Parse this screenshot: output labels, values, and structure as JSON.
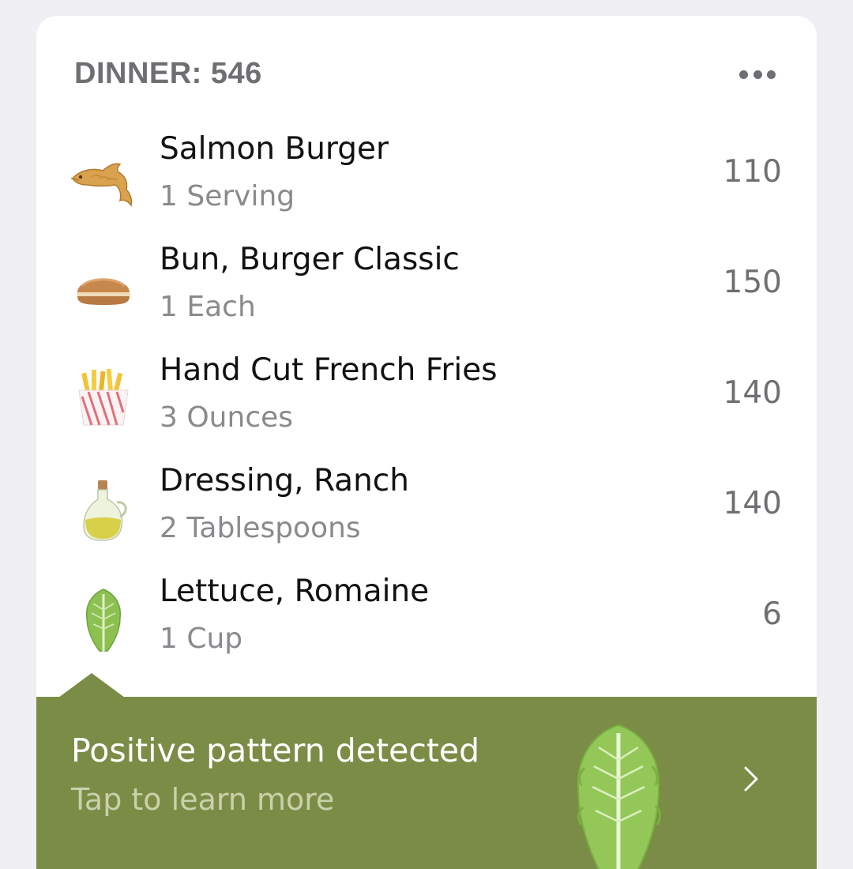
{
  "meal": {
    "header": "DINNER: 546",
    "more_icon": "more-horizontal-icon"
  },
  "items": [
    {
      "name": "Salmon Burger",
      "quantity": "1 Serving",
      "calories": "110",
      "icon": "fish-icon"
    },
    {
      "name": "Bun, Burger Classic",
      "quantity": "1 Each",
      "calories": "150",
      "icon": "bun-icon"
    },
    {
      "name": "Hand Cut French Fries",
      "quantity": "3 Ounces",
      "calories": "140",
      "icon": "fries-icon"
    },
    {
      "name": "Dressing, Ranch",
      "quantity": "2 Tablespoons",
      "calories": "140",
      "icon": "oil-bottle-icon"
    },
    {
      "name": "Lettuce, Romaine",
      "quantity": "1 Cup",
      "calories": "6",
      "icon": "lettuce-icon"
    }
  ],
  "insight": {
    "title": "Positive pattern detected",
    "subtitle": "Tap to learn more",
    "background": "#7b8c46",
    "icon": "lettuce-icon"
  }
}
